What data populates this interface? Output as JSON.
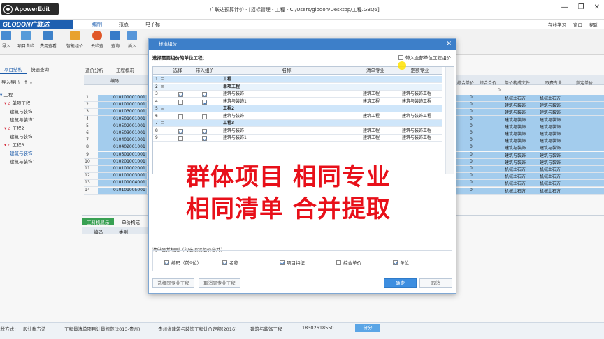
{
  "recorder": {
    "name": "ApowerEdit"
  },
  "window": {
    "title": "广联达预算计价 - [招标管理 - 工程 - C:/Users/glodon/Desktop/工程.GBQ5]",
    "controls": [
      "—",
      "❐",
      "✕"
    ]
  },
  "brand": {
    "logo": "GLODON广联达"
  },
  "ribbon": {
    "tabs": [
      "编制",
      "报表",
      "电子标"
    ],
    "active": "编制",
    "top_right": [
      "在线学习",
      "窗口",
      "帮助"
    ]
  },
  "toolbar": {
    "items": [
      "导入",
      "项目自检",
      "费用查看",
      "智能组价",
      "云检查",
      "查询",
      "插入"
    ]
  },
  "left_panel": {
    "tabs": [
      "项目结构",
      "快速查询"
    ],
    "actions": "导入导出 · ↑ ↓",
    "tree": [
      {
        "label": "工程",
        "level": 0
      },
      {
        "label": "单项工程",
        "level": 1
      },
      {
        "label": "建筑与装饰",
        "level": 2
      },
      {
        "label": "建筑与装饰1",
        "level": 2
      },
      {
        "label": "工程2",
        "level": 1
      },
      {
        "label": "建筑与装饰",
        "level": 2
      },
      {
        "label": "工程3",
        "level": 1
      },
      {
        "label": "建筑与装饰",
        "level": 2,
        "selected": true
      },
      {
        "label": "建筑与装饰1",
        "level": 2
      }
    ]
  },
  "main": {
    "tabs": [
      "造价分析",
      "工程概况"
    ],
    "grid_header": {
      "code": "编码",
      "cols_right": [
        "综合单价",
        "综合合价",
        "单价构成文件",
        "取费专业",
        "指定单价"
      ]
    },
    "total_value": "0",
    "rows": [
      {
        "n": "1",
        "code": "010101001001",
        "price": "0",
        "file": "机械土石方",
        "fee": "机械土石方"
      },
      {
        "n": "2",
        "code": "010101001001",
        "price": "0",
        "file": "建筑与装饰",
        "fee": "建筑与装饰"
      },
      {
        "n": "3",
        "code": "010103001001",
        "price": "0",
        "file": "建筑与装饰",
        "fee": "建筑与装饰"
      },
      {
        "n": "4",
        "code": "010501001001",
        "price": "0",
        "file": "建筑与装饰",
        "fee": "建筑与装饰"
      },
      {
        "n": "5",
        "code": "010502001001",
        "price": "0",
        "file": "建筑与装饰",
        "fee": "建筑与装饰"
      },
      {
        "n": "6",
        "code": "010503001001",
        "price": "0",
        "file": "建筑与装饰",
        "fee": "建筑与装饰"
      },
      {
        "n": "7",
        "code": "010401001001",
        "price": "0",
        "file": "建筑与装饰",
        "fee": "建筑与装饰"
      },
      {
        "n": "8",
        "code": "010402001001",
        "price": "0",
        "file": "建筑与装饰",
        "fee": "建筑与装饰"
      },
      {
        "n": "9",
        "code": "010501001001",
        "price": "0",
        "file": "建筑与装饰",
        "fee": "建筑与装饰"
      },
      {
        "n": "10",
        "code": "010201001001",
        "price": "0",
        "file": "建筑与装饰",
        "fee": "建筑与装饰"
      },
      {
        "n": "11",
        "code": "010101002001",
        "price": "0",
        "file": "机械土石方",
        "fee": "机械土石方"
      },
      {
        "n": "12",
        "code": "010101003001",
        "price": "0",
        "file": "机械土石方",
        "fee": "机械土石方"
      },
      {
        "n": "13",
        "code": "010101004001",
        "price": "0",
        "file": "机械土石方",
        "fee": "机械土石方"
      },
      {
        "n": "14",
        "code": "010101005001",
        "price": "0",
        "file": "机械土石方",
        "fee": "机械土石方"
      }
    ],
    "bottom_tabs": [
      "工料机显示",
      "单价构成"
    ],
    "bottom_header": [
      "编码",
      "类别"
    ]
  },
  "status_bar": {
    "items": [
      "计税方式：一般计税方法",
      "工程量清单项目计量规范(2013-贵州)",
      "贵州省建筑与装饰工程计价定额(2016)",
      "建筑与装饰工程",
      "18302618550"
    ],
    "button": "分分"
  },
  "dialog": {
    "title": "标准组价",
    "prompt": "选择需要组价的单位工程：",
    "include_all_label": "带入全部单位工程组价",
    "include_all_checked": false,
    "columns": [
      "选择",
      "带入组价",
      "名称",
      "清单专业",
      "定额专业"
    ],
    "rows": [
      {
        "n": "1",
        "tree": "⊟",
        "select": false,
        "include": false,
        "name": "工程",
        "bill": "",
        "quota": "",
        "type": "group"
      },
      {
        "n": "2",
        "tree": "⊟",
        "select": false,
        "include": false,
        "name": "单项工程",
        "bill": "",
        "quota": "",
        "type": "sub"
      },
      {
        "n": "3",
        "tree": "",
        "select": true,
        "include": true,
        "name": "建筑与装饰",
        "bill": "建筑工程",
        "quota": "建筑与装饰工程",
        "type": "item"
      },
      {
        "n": "4",
        "tree": "",
        "select": false,
        "include": true,
        "name": "建筑与装饰1",
        "bill": "建筑工程",
        "quota": "建筑与装饰工程",
        "type": "item"
      },
      {
        "n": "5",
        "tree": "⊟",
        "select": false,
        "include": false,
        "name": "工程2",
        "bill": "",
        "quota": "",
        "type": "group"
      },
      {
        "n": "6",
        "tree": "",
        "select": false,
        "include": false,
        "name": "建筑与装饰",
        "bill": "建筑工程",
        "quota": "建筑与装饰工程",
        "type": "item"
      },
      {
        "n": "7",
        "tree": "⊟",
        "select": false,
        "include": false,
        "name": "工程3",
        "bill": "",
        "quota": "",
        "type": "group"
      },
      {
        "n": "8",
        "tree": "",
        "select": true,
        "include": true,
        "name": "建筑与装饰",
        "bill": "建筑工程",
        "quota": "建筑与装饰工程",
        "type": "item"
      },
      {
        "n": "9",
        "tree": "",
        "select": false,
        "include": true,
        "name": "建筑与装饰1",
        "bill": "建筑工程",
        "quota": "建筑与装饰工程",
        "type": "item"
      }
    ],
    "overlay_line1": "群体项目 相同专业",
    "overlay_line2": "相同清单 合并提取",
    "merge_rule_label": "清单合并规则（勾选项需组价合并）",
    "merge_options": [
      {
        "label": "编码（前9位）",
        "checked": true
      },
      {
        "label": "名称",
        "checked": true
      },
      {
        "label": "项目特征",
        "checked": true
      },
      {
        "label": "综合单价",
        "checked": false
      },
      {
        "label": "单位",
        "checked": true
      }
    ],
    "buttons": {
      "select_same": "选择同专业工程",
      "unselect_same": "取消同专业工程",
      "ok": "确定",
      "cancel": "取消"
    }
  },
  "colors": {
    "accent": "#3d7fc9",
    "row_highlight": "#a9d3f5",
    "overlay_text": "#e8101a",
    "green_tab": "#3aa655"
  }
}
